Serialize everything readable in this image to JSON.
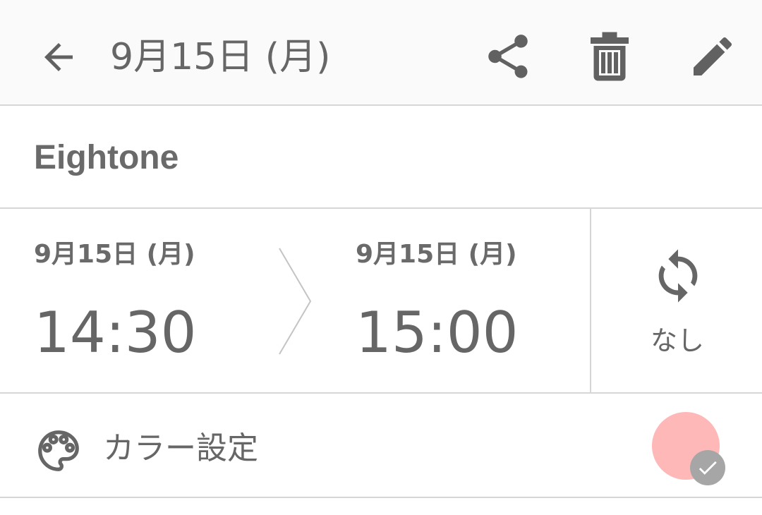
{
  "header": {
    "title": "9月15日 (月)",
    "back_icon": "arrow-left-icon",
    "share_icon": "share-icon",
    "delete_icon": "trash-icon",
    "edit_icon": "pencil-icon"
  },
  "event": {
    "title": "Eightone"
  },
  "time": {
    "start": {
      "date": "9月15日 (月)",
      "time": "14:30"
    },
    "end": {
      "date": "9月15日 (月)",
      "time": "15:00"
    }
  },
  "repeat": {
    "icon": "sync-icon",
    "label": "なし"
  },
  "color_setting": {
    "icon": "palette-icon",
    "label": "カラー設定",
    "selected_color": "#ffb8b8",
    "check_icon": "check-icon"
  },
  "colors": {
    "text": "#666666",
    "icon": "#616161",
    "divider": "#d6d6d6",
    "badge": "#a6a6a6"
  }
}
